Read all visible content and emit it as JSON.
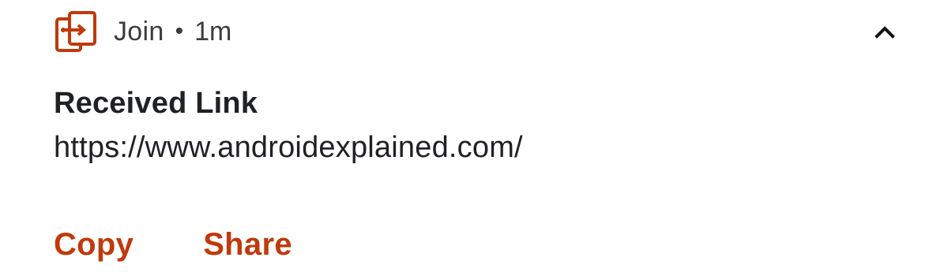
{
  "notification": {
    "app_icon": "join-app-icon",
    "accent_color": "#bf3a0c",
    "app_name": "Join",
    "separator": "•",
    "time": "1m",
    "expand_icon": "chevron-up-icon",
    "title": "Received Link",
    "text": "https://www.androidexplained.com/",
    "actions": [
      {
        "label": "Copy"
      },
      {
        "label": "Share"
      }
    ]
  }
}
